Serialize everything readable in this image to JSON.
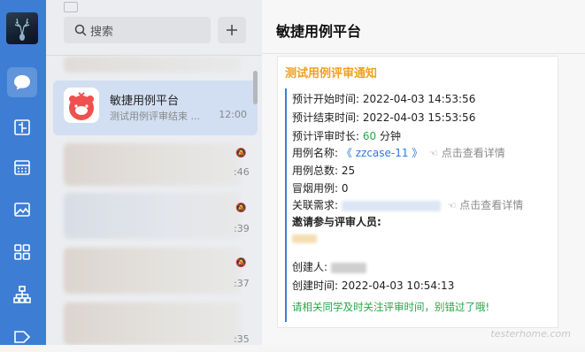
{
  "search": {
    "placeholder": "搜索"
  },
  "active_chat": {
    "title": "敏捷用例平台",
    "preview": "测试用例评审结束 ...",
    "time": "12:00"
  },
  "list_times": [
    ":46",
    ":39",
    ":37",
    ":35"
  ],
  "chat": {
    "title": "敏捷用例平台",
    "card_title": "测试用例评审通知",
    "start_label": "预计开始时间:",
    "start_value": "2022-04-03 14:53:56",
    "end_label": "预计结束时间:",
    "end_value": "2022-04-03 15:53:56",
    "duration_label": "预计评审时长:",
    "duration_value": "60",
    "duration_unit": "分钟",
    "case_name_label": "用例名称:",
    "case_name_open": "《",
    "case_name_value": "zzcase-11",
    "case_name_close": "》",
    "view_detail": "点击查看详情",
    "total_label": "用例总数:",
    "total_value": "25",
    "smoke_label": "冒烟用例:",
    "smoke_value": "0",
    "req_label": "关联需求:",
    "invite_label": "邀请参与评审人员:",
    "creator_label": "创建人:",
    "created_time_label": "创建时间:",
    "created_time_value": "2022-04-03 10:54:13",
    "reminder": "请相关同学及时关注评审时间，别错过了哦!"
  },
  "watermark": "testerhome.com",
  "colors": {
    "rail": "#3d7dd4",
    "card_title": "#f0a020",
    "link": "#2a7ae2",
    "green": "#25a745",
    "active_item": "#d2dff2"
  }
}
